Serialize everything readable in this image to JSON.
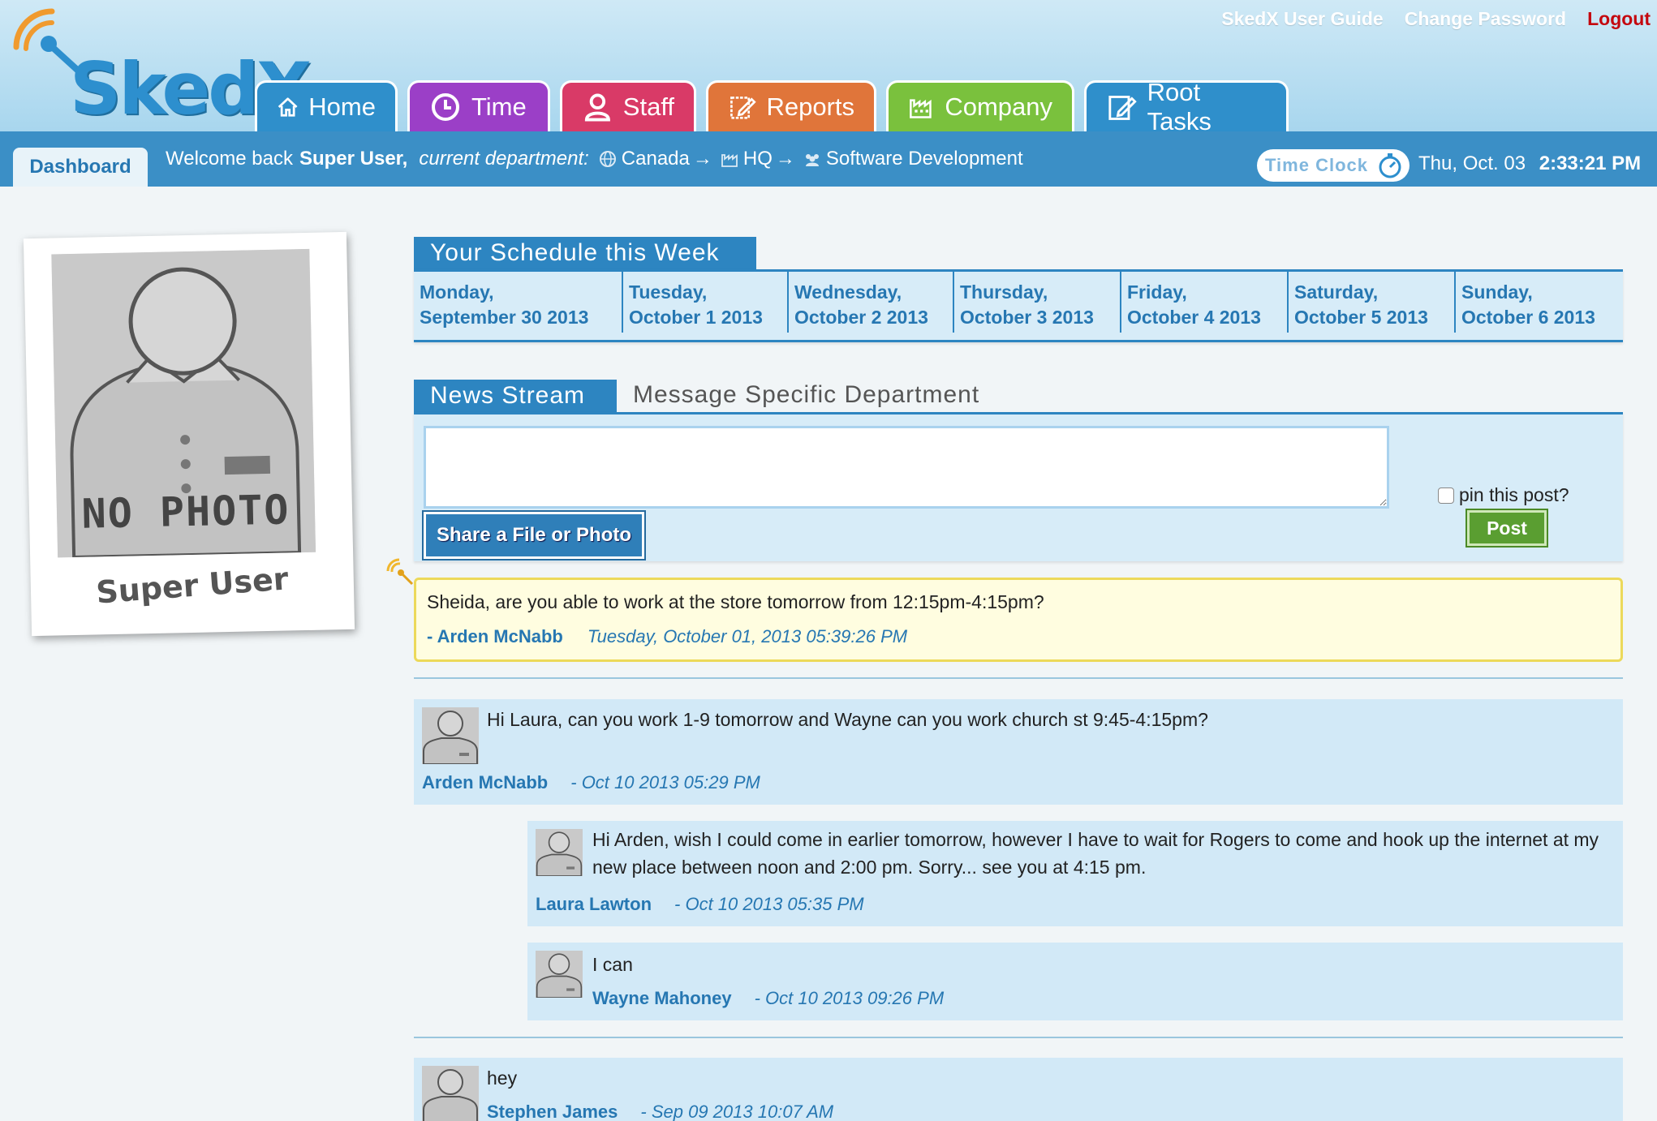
{
  "app": {
    "logo_text": "SkedX"
  },
  "top_links": {
    "guide": "SkedX User Guide",
    "change_password": "Change Password",
    "logout": "Logout"
  },
  "tabs": [
    {
      "label": "Home",
      "icon": "home-icon"
    },
    {
      "label": "Time",
      "icon": "clock-icon"
    },
    {
      "label": "Staff",
      "icon": "person-icon"
    },
    {
      "label": "Reports",
      "icon": "pencil-note-icon"
    },
    {
      "label": "Company",
      "icon": "factory-icon"
    },
    {
      "label": "Root Tasks",
      "icon": "pencil-note-icon"
    }
  ],
  "nav": {
    "dashboard_label": "Dashboard",
    "welcome_prefix": "Welcome back",
    "user_name": "Super User,",
    "dept_label": "current department:",
    "dept_path": [
      "Canada",
      "HQ",
      "Software Development"
    ],
    "arrow": "→",
    "timeclock_label": "Time Clock",
    "date": "Thu, Oct. 03",
    "time": "2:33:21 PM"
  },
  "profile": {
    "photo_placeholder": "NO PHOTO",
    "name": "Super User"
  },
  "schedule": {
    "title": "Your Schedule this Week",
    "days": [
      {
        "day": "Monday,",
        "date": "September 30 2013"
      },
      {
        "day": "Tuesday,",
        "date": "October 1 2013"
      },
      {
        "day": "Wednesday,",
        "date": "October 2 2013"
      },
      {
        "day": "Thursday,",
        "date": "October 3 2013"
      },
      {
        "day": "Friday,",
        "date": "October 4 2013"
      },
      {
        "day": "Saturday,",
        "date": "October 5 2013"
      },
      {
        "day": "Sunday,",
        "date": "October 6 2013"
      }
    ]
  },
  "news": {
    "tab_active": "News Stream",
    "tab_other": "Message Specific Department",
    "post_placeholder": "",
    "share_label": "Share a File or Photo",
    "pin_label": "pin this post?",
    "post_label": "Post",
    "pinned": {
      "message": "Sheida,  are you able to work at the store tomorrow from 12:15pm-4:15pm?",
      "author": "- Arden McNabb",
      "timestamp": "Tuesday, October 01, 2013 05:39:26 PM"
    },
    "posts": [
      {
        "text": "Hi Laura, can you work 1-9 tomorrow and Wayne can you work church st 9:45-4:15pm?",
        "author": "Arden McNabb",
        "timestamp": "- Oct 10 2013 05:29 PM"
      },
      {
        "text": "Hi Arden, wish I could come in earlier tomorrow, however I have to wait for Rogers to come and hook up the internet at my new place between noon and 2:00 pm. Sorry... see you at 4:15 pm.",
        "author": "Laura Lawton",
        "timestamp": "- Oct 10 2013 05:35 PM"
      },
      {
        "text": "I can",
        "author": "Wayne Mahoney",
        "timestamp": "- Oct 10 2013 09:26 PM"
      },
      {
        "text": "hey",
        "author": "Stephen James",
        "timestamp": "- Sep 09 2013 10:07 AM"
      }
    ]
  },
  "colors": {
    "brand_blue": "#2d85c1",
    "logout_red": "#c4080e",
    "post_green": "#5a9e31",
    "pinned_bg": "#fffde0"
  }
}
